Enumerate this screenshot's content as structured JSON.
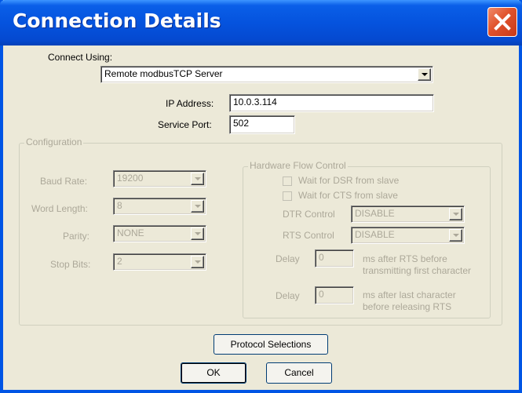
{
  "window": {
    "title": "Connection Details"
  },
  "connect": {
    "label": "Connect Using:",
    "value": "Remote modbusTCP Server"
  },
  "ip": {
    "label": "IP Address:",
    "value": "10.0.3.114"
  },
  "port": {
    "label": "Service Port:",
    "value": "502"
  },
  "configuration": {
    "title": "Configuration",
    "baud": {
      "label": "Baud Rate:",
      "value": "19200"
    },
    "word_length": {
      "label": "Word Length:",
      "value": "8"
    },
    "parity": {
      "label": "Parity:",
      "value": "NONE"
    },
    "stop_bits": {
      "label": "Stop Bits:",
      "value": "2"
    }
  },
  "hardware": {
    "title": "Hardware Flow Control",
    "wait_dsr": "Wait for DSR from slave",
    "wait_cts": "Wait for CTS from slave",
    "dtr": {
      "label": "DTR Control",
      "value": "DISABLE"
    },
    "rts": {
      "label": "RTS Control",
      "value": "DISABLE"
    },
    "delay1": {
      "label": "Delay",
      "value": "0",
      "desc_line1": "ms after RTS before",
      "desc_line2": "transmitting first character"
    },
    "delay2": {
      "label": "Delay",
      "value": "0",
      "desc_line1": "ms after last character",
      "desc_line2": "before releasing RTS"
    }
  },
  "buttons": {
    "protocol": "Protocol Selections",
    "ok": "OK",
    "cancel": "Cancel"
  },
  "icons": {
    "close": "close-icon",
    "dropdown": "chevron-down-icon"
  },
  "colors": {
    "titlebar": "#0553de",
    "close": "#e0522c",
    "background": "#ece9d8"
  }
}
